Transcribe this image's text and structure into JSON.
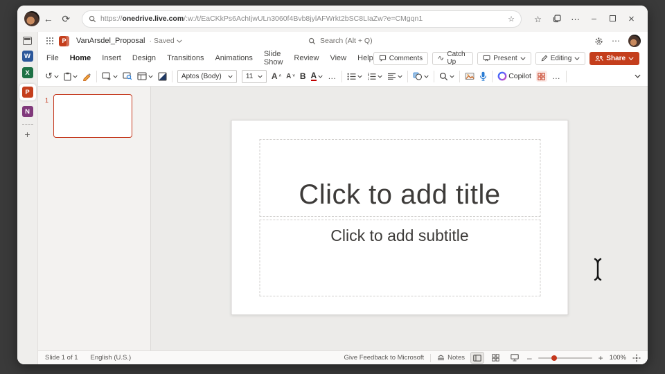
{
  "browser": {
    "url_prefix": "https://",
    "url_host": "onedrive.live.com",
    "url_rest": "/:w:/t/EaCKkPs6AchIjwULn3060f4Bvb8jylAFWrkt2bSC8LIaZw?e=CMgqn1"
  },
  "glyphs": {
    "back": "←",
    "refresh": "⟳",
    "ellipsis_v": "⋯",
    "ellipsis_h": "…",
    "minimize": "–",
    "close": "×",
    "star": "☆",
    "plus": "+",
    "undo": "↺",
    "dot_separator": "·"
  },
  "rail": {
    "word": "W",
    "excel": "X",
    "powerpoint": "P",
    "onenote": "N"
  },
  "header": {
    "doc_title": "VanArsdel_Proposal",
    "save_status": "Saved",
    "search_label": "Search (Alt + Q)"
  },
  "menubar": {
    "items": [
      "File",
      "Home",
      "Insert",
      "Design",
      "Transitions",
      "Animations",
      "Slide Show",
      "Review",
      "View",
      "Help"
    ],
    "active": "Home"
  },
  "actions": {
    "comments": "Comments",
    "catch_up": "Catch Up",
    "present": "Present",
    "editing": "Editing",
    "share": "Share"
  },
  "ribbon": {
    "font_name": "Aptos (Body)",
    "font_size": "11",
    "bold": "B",
    "grow_font": "A",
    "shrink_font": "A",
    "font_color": "A",
    "copilot": "Copilot"
  },
  "slide_panel": {
    "slide_number": "1"
  },
  "slide": {
    "title_placeholder": "Click to add title",
    "subtitle_placeholder": "Click to add subtitle"
  },
  "statusbar": {
    "slide_indicator": "Slide 1 of 1",
    "language": "English (U.S.)",
    "feedback": "Give Feedback to Microsoft",
    "notes": "Notes",
    "zoom_level": "100%"
  },
  "colors": {
    "accent": "#C43E1C",
    "word_blue": "#2B579A",
    "excel_green": "#1E7145",
    "onenote_purple": "#80397B",
    "dictate_blue": "#2B7CD3",
    "font_color_red": "#C00000"
  }
}
